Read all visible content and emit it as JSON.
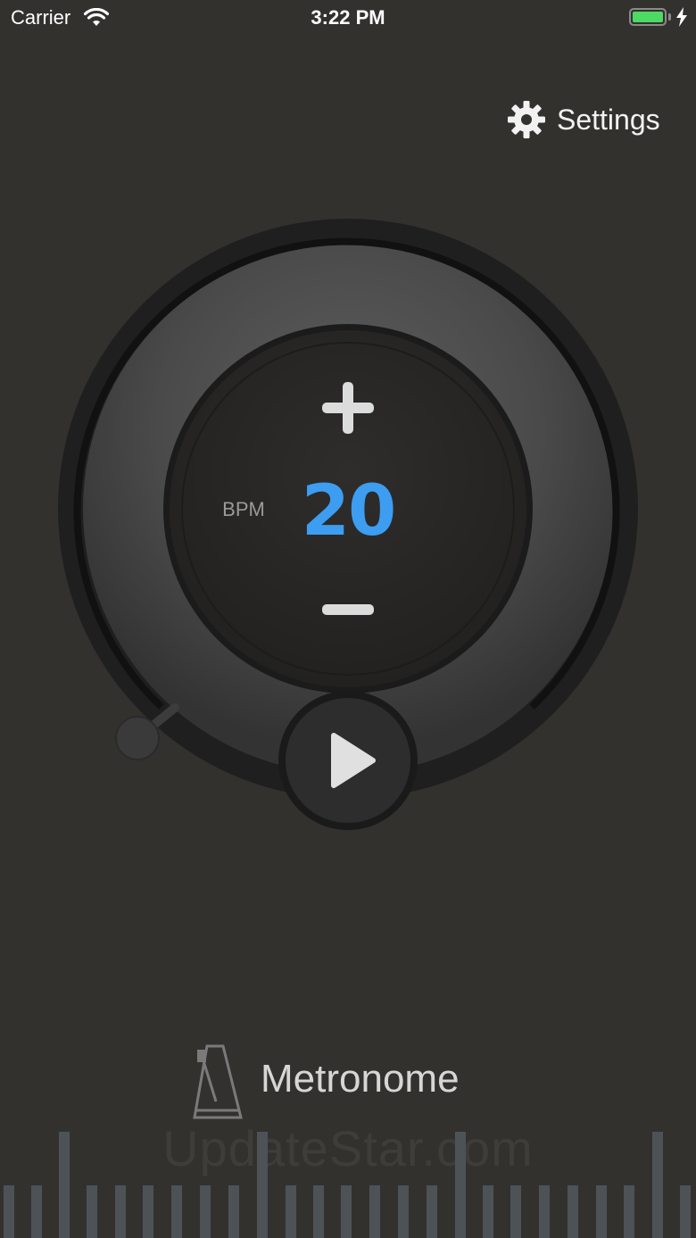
{
  "status_bar": {
    "carrier": "Carrier",
    "time": "3:22 PM",
    "battery_color": "#4cd964"
  },
  "settings": {
    "label": "Settings",
    "icon": "gear-icon"
  },
  "dial": {
    "bpm_label": "BPM",
    "bpm_value": "20",
    "accent_color": "#3d9df0",
    "increment_icon": "plus-icon",
    "decrement_icon": "minus-icon",
    "play_icon": "play-icon"
  },
  "footer": {
    "logo_icon": "metronome-icon",
    "title": "Metronome",
    "watermark": "UpdateStar.com"
  }
}
